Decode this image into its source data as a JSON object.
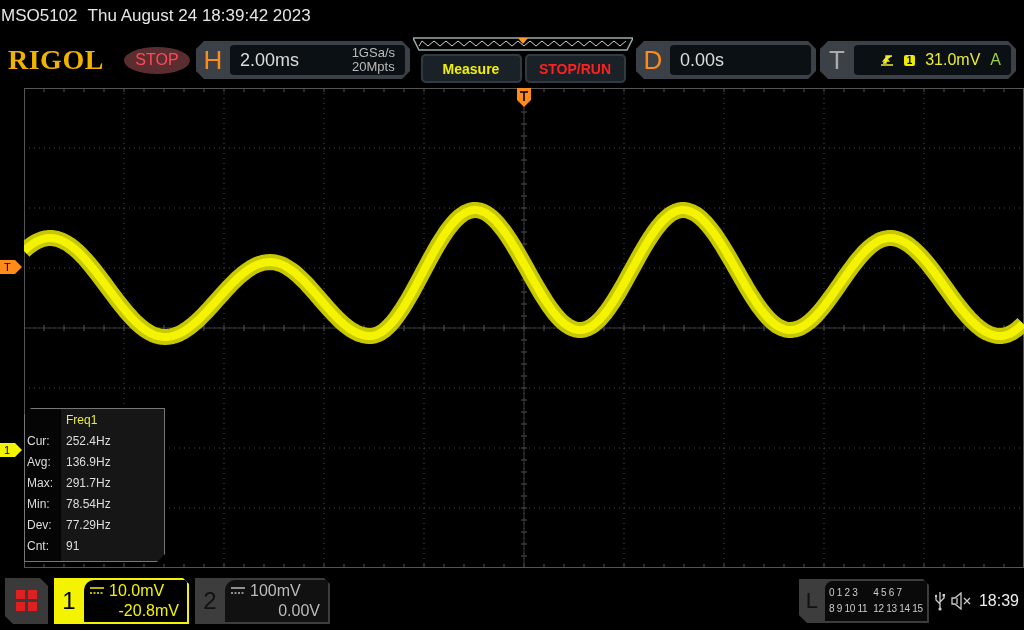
{
  "header": {
    "model": "MSO5102",
    "datetime": "Thu August 24 18:39:42 2023"
  },
  "toolbar": {
    "logo": "RIGOL",
    "run_state": {
      "label": "STOP",
      "kind": "stop"
    },
    "horizontal": {
      "key": "H",
      "timebase": "2.00ms",
      "sample_rate": "1GSa/s",
      "memory_depth": "20Mpts"
    },
    "buttons": [
      {
        "label": "Measure",
        "kind": "measure"
      },
      {
        "label": "STOP/RUN",
        "kind": "run"
      }
    ],
    "delay": {
      "key": "D",
      "value": "0.00s"
    },
    "trigger": {
      "key": "T",
      "source": "1",
      "level": "31.0mV",
      "mode": "A"
    }
  },
  "display": {
    "trigger_level_marker": "T",
    "channel_marker": "1",
    "measurement": {
      "title": "Freq1",
      "rows": [
        {
          "label": "Cur:",
          "value": "252.4Hz"
        },
        {
          "label": "Avg:",
          "value": "136.9Hz"
        },
        {
          "label": "Max:",
          "value": "291.7Hz"
        },
        {
          "label": "Min:",
          "value": "78.54Hz"
        },
        {
          "label": "Dev:",
          "value": "77.29Hz"
        },
        {
          "label": "Cnt:",
          "value": "91"
        }
      ]
    }
  },
  "bottom_bar": {
    "channels": [
      {
        "number": "1",
        "scale": "10.0mV",
        "offset": "-20.8mV",
        "active": true
      },
      {
        "number": "2",
        "scale": "100mV",
        "offset": "0.00V",
        "active": false
      }
    ],
    "logic": {
      "key": "L",
      "groups": [
        "0 1 2 3",
        "4 5 6 7",
        "8 9 10 11",
        "12 13 14 15"
      ]
    },
    "clock": "18:39"
  }
}
